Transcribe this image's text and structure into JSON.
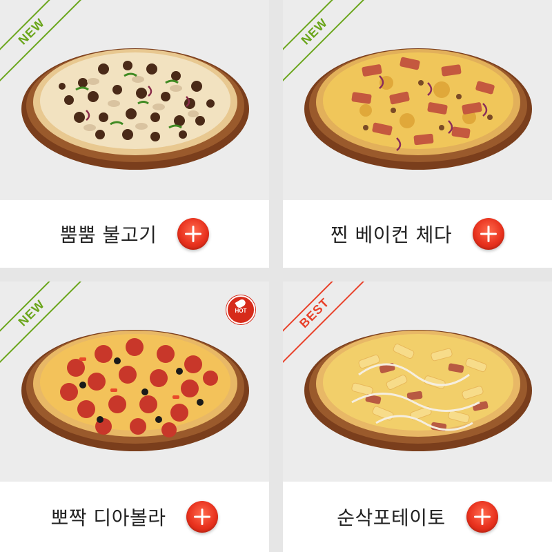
{
  "products": [
    {
      "name": "뿜뿜 불고기",
      "ribbon": "NEW",
      "ribbon_color": "#6aa51b",
      "hot": false,
      "icon": "plus-icon"
    },
    {
      "name": "찐 베이컨 체다",
      "ribbon": "NEW",
      "ribbon_color": "#6aa51b",
      "hot": false,
      "icon": "plus-icon"
    },
    {
      "name": "뽀짝 디아볼라",
      "ribbon": "NEW",
      "ribbon_color": "#6aa51b",
      "hot": true,
      "hot_label": "HOT",
      "icon": "plus-icon"
    },
    {
      "name": "순삭포테이토",
      "ribbon": "BEST",
      "ribbon_color": "#e8412a",
      "hot": false,
      "icon": "plus-icon"
    }
  ],
  "colors": {
    "background": "#e6e6e6",
    "add_button": "#e8321e",
    "new_ribbon": "#6aa51b",
    "best_ribbon": "#e8412a",
    "hot_badge": "#d62b1a"
  }
}
